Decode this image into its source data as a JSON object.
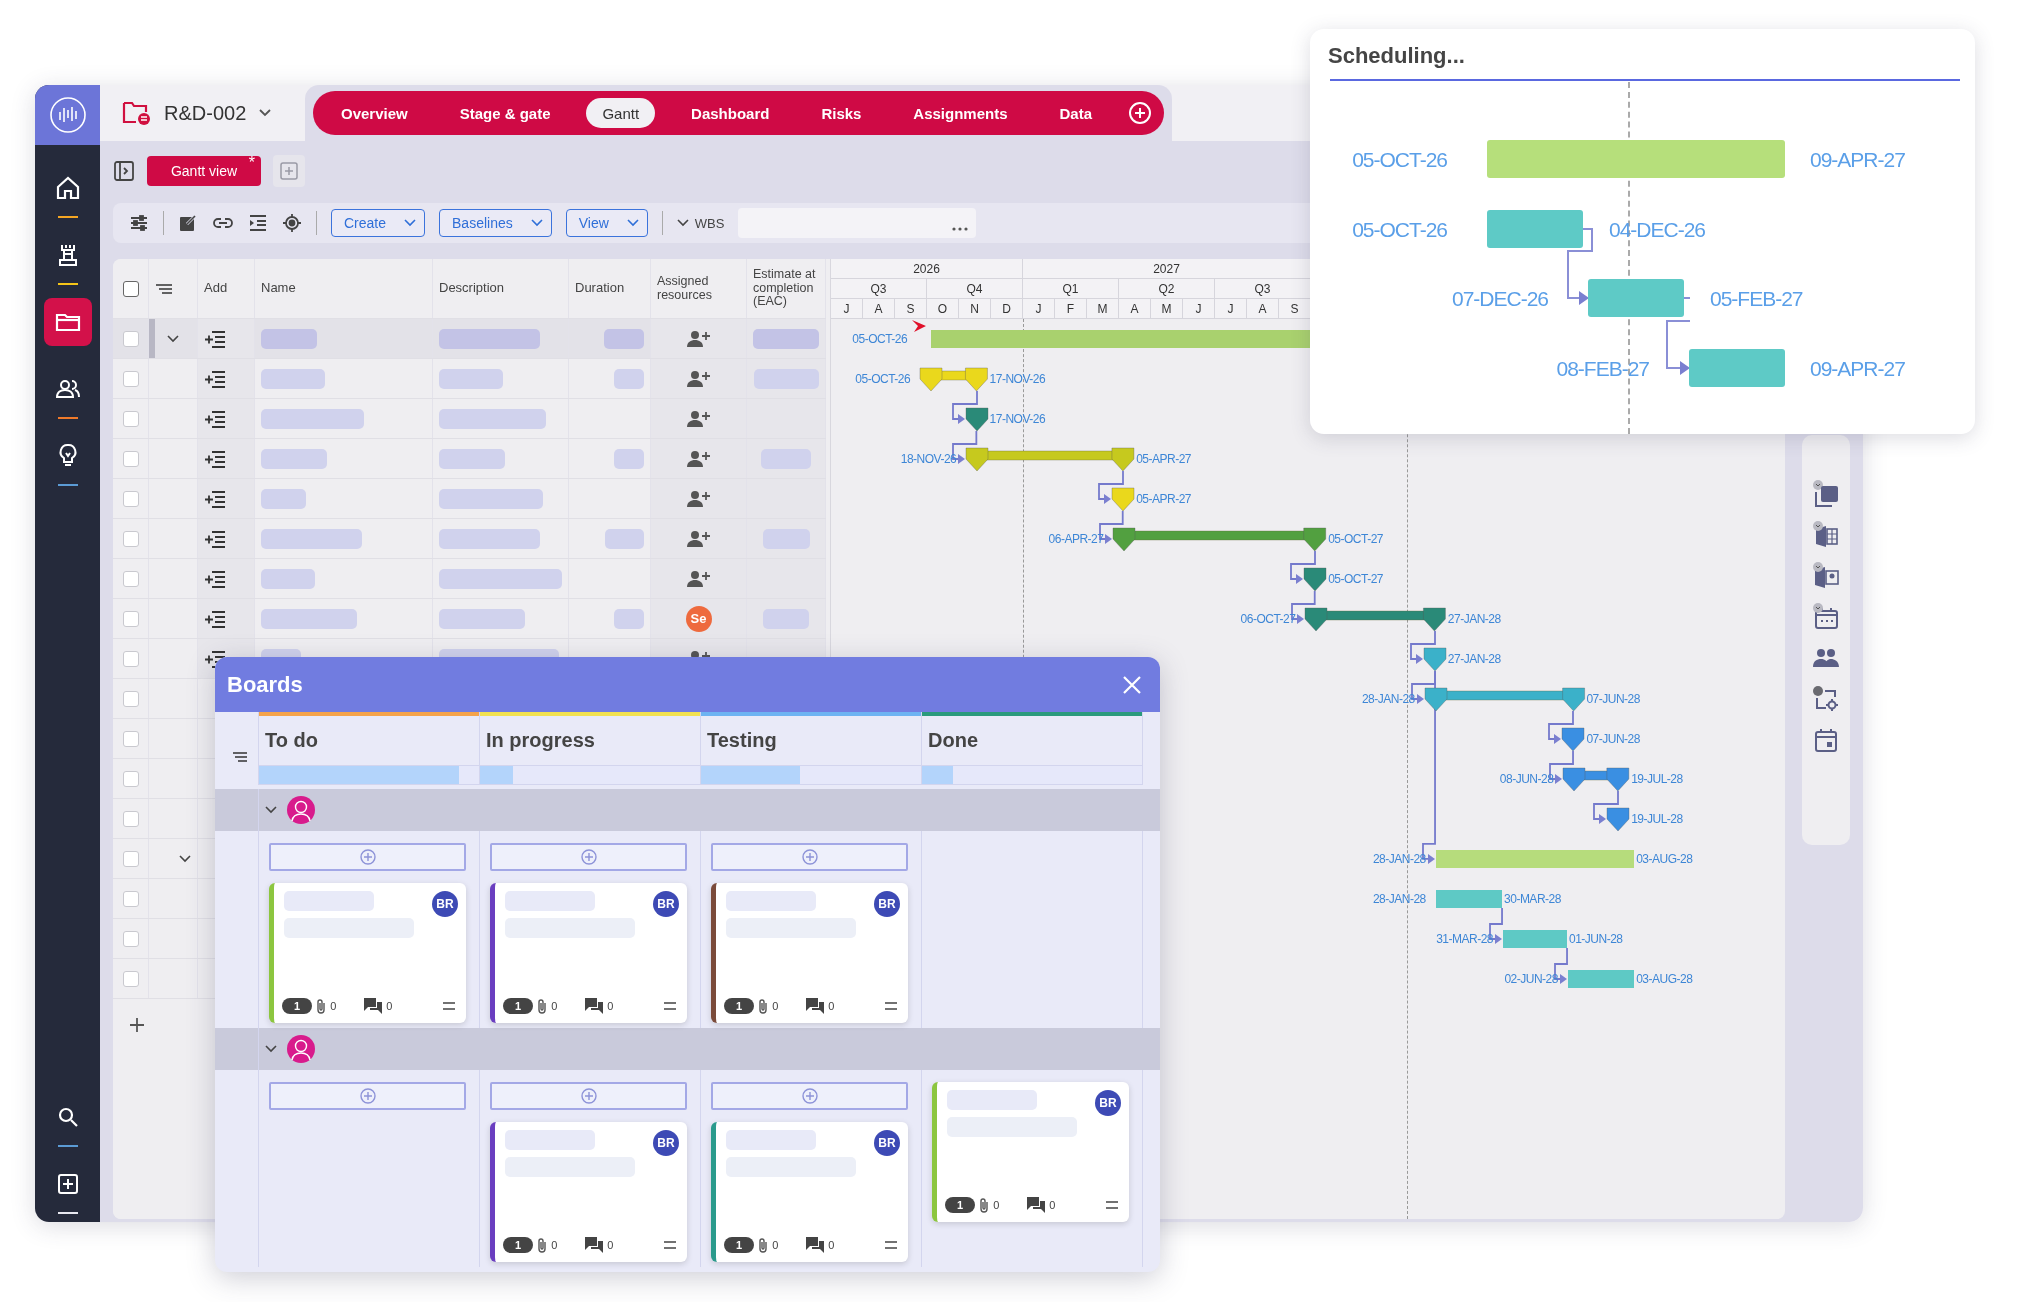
{
  "sidebar": {
    "items": [
      {
        "kind": "home",
        "selected": false,
        "color": "#f5a623"
      },
      {
        "kind": "rook",
        "selected": false,
        "color": "#f5c518"
      },
      {
        "kind": "folder",
        "selected": true
      },
      {
        "kind": "people",
        "selected": false,
        "color": "#f07a2a"
      },
      {
        "kind": "bulb",
        "selected": false,
        "color": "#5b9bd5"
      }
    ],
    "bottom_items": [
      {
        "kind": "search",
        "color": "#5b9bd5"
      },
      {
        "kind": "add",
        "color": "#e8e8f0"
      }
    ]
  },
  "header": {
    "project": "R&D-002",
    "tabs": [
      {
        "label": "Overview",
        "selected": false
      },
      {
        "label": "Stage & gate",
        "selected": false
      },
      {
        "label": "Gantt",
        "selected": true
      },
      {
        "label": "Dashboard",
        "selected": false
      },
      {
        "label": "Risks",
        "selected": false
      },
      {
        "label": "Assignments",
        "selected": false
      },
      {
        "label": "Data",
        "selected": false
      }
    ]
  },
  "views": [
    {
      "label": "Gantt view",
      "flag": "*",
      "selected": true
    }
  ],
  "toolbar": {
    "dropdowns": [
      "Create",
      "Baselines",
      "View"
    ],
    "wbs": "WBS"
  },
  "table": {
    "all_checked": false,
    "columns": [
      "Add",
      "Name",
      "Description",
      "Duration",
      "Assigned resources",
      "Estimate at completion (EAC)"
    ],
    "rows": [
      {
        "kind": "task",
        "checked": false,
        "expanded": true
      },
      {
        "kind": "task",
        "checked": false
      },
      {
        "kind": "task",
        "checked": false
      },
      {
        "kind": "task",
        "checked": false
      },
      {
        "kind": "task",
        "checked": false
      },
      {
        "kind": "task",
        "checked": false
      },
      {
        "kind": "task",
        "checked": false
      },
      {
        "kind": "task",
        "checked": false,
        "assignee": "Se"
      },
      {
        "kind": "task",
        "checked": false
      },
      {
        "kind": "stub",
        "checked": false
      },
      {
        "kind": "stub",
        "checked": false
      },
      {
        "kind": "stub",
        "checked": false
      },
      {
        "kind": "stub",
        "checked": false
      },
      {
        "kind": "stub",
        "checked": false,
        "expanded": true
      },
      {
        "kind": "stub",
        "checked": false
      },
      {
        "kind": "stub",
        "checked": false
      },
      {
        "kind": "stub",
        "checked": false
      }
    ]
  },
  "gantt": {
    "timeline": [
      {
        "year": "2026",
        "quarters": [
          {
            "label": "Q3",
            "months": [
              "J",
              "A",
              "S"
            ]
          },
          {
            "label": "Q4",
            "months": [
              "O",
              "N",
              "D"
            ]
          }
        ]
      },
      {
        "year": "2027",
        "quarters": [
          {
            "label": "Q1",
            "months": [
              "J",
              "F",
              "M"
            ]
          },
          {
            "label": "Q2",
            "months": [
              "A",
              "M",
              "J"
            ]
          },
          {
            "label": "Q3",
            "months": [
              "J",
              "A",
              "S"
            ]
          }
        ]
      }
    ],
    "tasks": [
      {
        "kind": "summary",
        "start": "05-OCT-26",
        "color": "#a9d16e"
      },
      {
        "kind": "group",
        "start": "05-OCT-26",
        "end": "17-NOV-26",
        "color": "#ead81c"
      },
      {
        "kind": "milestone",
        "date": "17-NOV-26",
        "color": "#2a8a78"
      },
      {
        "kind": "group",
        "start": "18-NOV-26",
        "end": "05-APR-27",
        "color": "#c6c91e"
      },
      {
        "kind": "milestone",
        "date": "05-APR-27",
        "color": "#ead81c"
      },
      {
        "kind": "group",
        "start": "06-APR-27",
        "end": "05-OCT-27",
        "color": "#52a040"
      },
      {
        "kind": "milestone",
        "date": "05-OCT-27",
        "color": "#2a8a78"
      },
      {
        "kind": "group",
        "start": "06-OCT-27",
        "end": "27-JAN-28",
        "color": "#2a8a78"
      },
      {
        "kind": "milestone",
        "date": "27-JAN-28",
        "color": "#3bb1c9"
      },
      {
        "kind": "group",
        "start": "28-JAN-28",
        "end": "07-JUN-28",
        "color": "#3bb1c9"
      },
      {
        "kind": "milestone",
        "date": "07-JUN-28",
        "color": "#3a8fe2"
      },
      {
        "kind": "group",
        "start": "08-JUN-28",
        "end": "19-JUL-28",
        "color": "#3a8fe2"
      },
      {
        "kind": "milestone",
        "date": "19-JUL-28",
        "color": "#3a8fe2"
      },
      {
        "kind": "bar",
        "start": "28-JAN-28",
        "end": "03-AUG-28",
        "color": "#b6dc7c"
      },
      {
        "kind": "bar",
        "start": "28-JAN-28",
        "end": "30-MAR-28",
        "color": "#5ec9c5"
      },
      {
        "kind": "bar",
        "start": "31-MAR-28",
        "end": "01-JUN-28",
        "color": "#5ec9c5"
      },
      {
        "kind": "bar",
        "start": "02-JUN-28",
        "end": "03-AUG-28",
        "color": "#5ec9c5"
      }
    ]
  },
  "side_tools": [
    {
      "kind": "document"
    },
    {
      "kind": "spreadsheet"
    },
    {
      "kind": "slides"
    },
    {
      "kind": "calendar_dots"
    },
    {
      "kind": "people"
    },
    {
      "kind": "workflow"
    },
    {
      "kind": "calendar"
    }
  ],
  "scheduling": {
    "title": "Scheduling...",
    "tasks": [
      {
        "start": "05-OCT-26",
        "end": "09-APR-27",
        "color": "#b6df7b"
      },
      {
        "start": "05-OCT-26",
        "end": "04-DEC-26",
        "color": "#5ecac6"
      },
      {
        "start": "07-DEC-26",
        "end": "05-FEB-27",
        "color": "#5ecac6"
      },
      {
        "start": "08-FEB-27",
        "end": "09-APR-27",
        "color": "#5ecac6"
      }
    ]
  },
  "boards": {
    "title": "Boards",
    "columns": [
      {
        "title": "To do",
        "color": "#f5a34a",
        "level": 0.91
      },
      {
        "title": "In progress",
        "color": "#f2e150",
        "level": 0.15
      },
      {
        "title": "Testing",
        "color": "#6db3f2",
        "level": 0.45
      },
      {
        "title": "Done",
        "color": "#2a9a7c",
        "level": 0.14
      }
    ],
    "lanes": [
      {
        "expanded": true,
        "cells": [
          {
            "add": true,
            "cards": [
              {
                "color": "#8cc63f",
                "badge": "1",
                "attachments": "0",
                "comments": "0",
                "assignee": "BR"
              }
            ]
          },
          {
            "add": true,
            "cards": [
              {
                "color": "#6a3ec0",
                "badge": "1",
                "attachments": "0",
                "comments": "0",
                "assignee": "BR"
              }
            ]
          },
          {
            "add": true,
            "cards": [
              {
                "color": "#7b4b3a",
                "badge": "1",
                "attachments": "0",
                "comments": "0",
                "assignee": "BR"
              }
            ]
          },
          {
            "add": false
          }
        ]
      },
      {
        "expanded": true,
        "cells": [
          {
            "add": true
          },
          {
            "add": true,
            "cards": [
              {
                "color": "#6a3ec0",
                "badge": "1",
                "attachments": "0",
                "comments": "0",
                "assignee": "BR"
              }
            ]
          },
          {
            "add": true,
            "cards": [
              {
                "color": "#2a9a8c",
                "badge": "1",
                "attachments": "0",
                "comments": "0",
                "assignee": "BR"
              }
            ]
          },
          {
            "add": false,
            "cards": [
              {
                "color": "#8cc63f",
                "badge": "1",
                "attachments": "0",
                "comments": "0",
                "assignee": "BR"
              }
            ]
          }
        ]
      }
    ]
  }
}
